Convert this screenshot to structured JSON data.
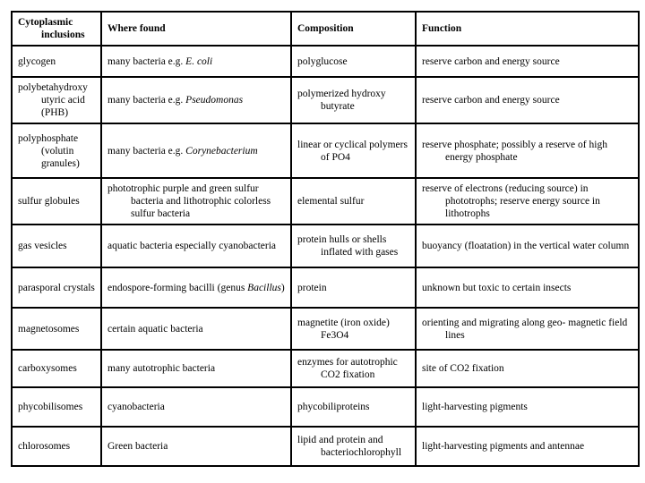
{
  "table": {
    "headers": [
      "Cytoplasmic inclusions",
      "Where found",
      "Composition",
      "Function"
    ],
    "rows": [
      {
        "inclusion": "glycogen",
        "where_pre": "many bacteria e.g. ",
        "where_italic": "E. coli",
        "where_post": "",
        "composition": "polyglucose",
        "function": "reserve carbon and energy source"
      },
      {
        "inclusion": "polybetahydroxy utyric acid (PHB)",
        "where_pre": "many bacteria e.g. ",
        "where_italic": "Pseudomonas",
        "where_post": "",
        "composition": "polymerized hydroxy butyrate",
        "function": "reserve carbon and energy source"
      },
      {
        "inclusion": "polyphosphate (volutin granules)",
        "where_pre": "many bacteria e.g. ",
        "where_italic": "Corynebacterium",
        "where_post": "",
        "composition": "linear or cyclical polymers of PO4",
        "function": "reserve phosphate; possibly a reserve of high energy phosphate"
      },
      {
        "inclusion": "sulfur globules",
        "where_pre": "phototrophic purple and green sulfur bacteria and lithotrophic colorless sulfur bacteria",
        "where_italic": "",
        "where_post": "",
        "composition": "elemental sulfur",
        "function": "reserve of electrons (reducing source) in phototrophs; reserve energy source in lithotrophs"
      },
      {
        "inclusion": "gas vesicles",
        "where_pre": "aquatic bacteria especially cyanobacteria",
        "where_italic": "",
        "where_post": "",
        "composition": "protein hulls or shells inflated with gases",
        "function": "buoyancy (floatation) in the vertical water column"
      },
      {
        "inclusion": "parasporal crystals",
        "where_pre": "endospore-forming bacilli (genus ",
        "where_italic": "Bacillus",
        "where_post": ")",
        "composition": "protein",
        "function": "unknown but toxic to certain insects"
      },
      {
        "inclusion": "magnetosomes",
        "where_pre": "certain aquatic bacteria",
        "where_italic": "",
        "where_post": "",
        "composition": "magnetite (iron oxide) Fe3O4",
        "function": "orienting and migrating along geo- magnetic field lines"
      },
      {
        "inclusion": "carboxysomes",
        "where_pre": "many autotrophic bacteria",
        "where_italic": "",
        "where_post": "",
        "composition": "enzymes for autotrophic CO2 fixation",
        "function": "site of CO2 fixation"
      },
      {
        "inclusion": "phycobilisomes",
        "where_pre": "cyanobacteria",
        "where_italic": "",
        "where_post": "",
        "composition": "phycobiliproteins",
        "function": "light-harvesting pigments"
      },
      {
        "inclusion": "chlorosomes",
        "where_pre": "Green bacteria",
        "where_italic": "",
        "where_post": "",
        "composition": "lipid and protein and bacteriochlorophyll",
        "function": "light-harvesting pigments and antennae"
      }
    ]
  }
}
